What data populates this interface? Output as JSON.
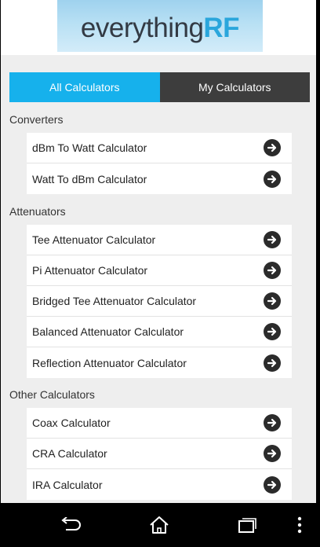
{
  "header": {
    "logo_part1": "everything",
    "logo_part2": "RF"
  },
  "tabs": [
    {
      "label": "All Calculators",
      "active": true
    },
    {
      "label": "My Calculators",
      "active": false
    }
  ],
  "sections": [
    {
      "title": "Converters",
      "items": [
        "dBm To Watt Calculator",
        "Watt To dBm Calculator"
      ]
    },
    {
      "title": "Attenuators",
      "items": [
        "Tee Attenuator Calculator",
        "Pi Attenuator Calculator",
        "Bridged Tee Attenuator Calculator",
        "Balanced Attenuator Calculator",
        "Reflection Attenuator Calculator"
      ]
    },
    {
      "title": "Other Calculators",
      "items": [
        "Coax Calculator",
        "CRA Calculator",
        "IRA Calculator"
      ]
    }
  ],
  "navbar": {
    "icons": [
      "back-icon",
      "home-icon",
      "recent-apps-icon",
      "overflow-menu-icon"
    ]
  },
  "colors": {
    "accent": "#16b1ec",
    "tab_inactive": "#3d3d3d",
    "background": "#eeeeee"
  }
}
